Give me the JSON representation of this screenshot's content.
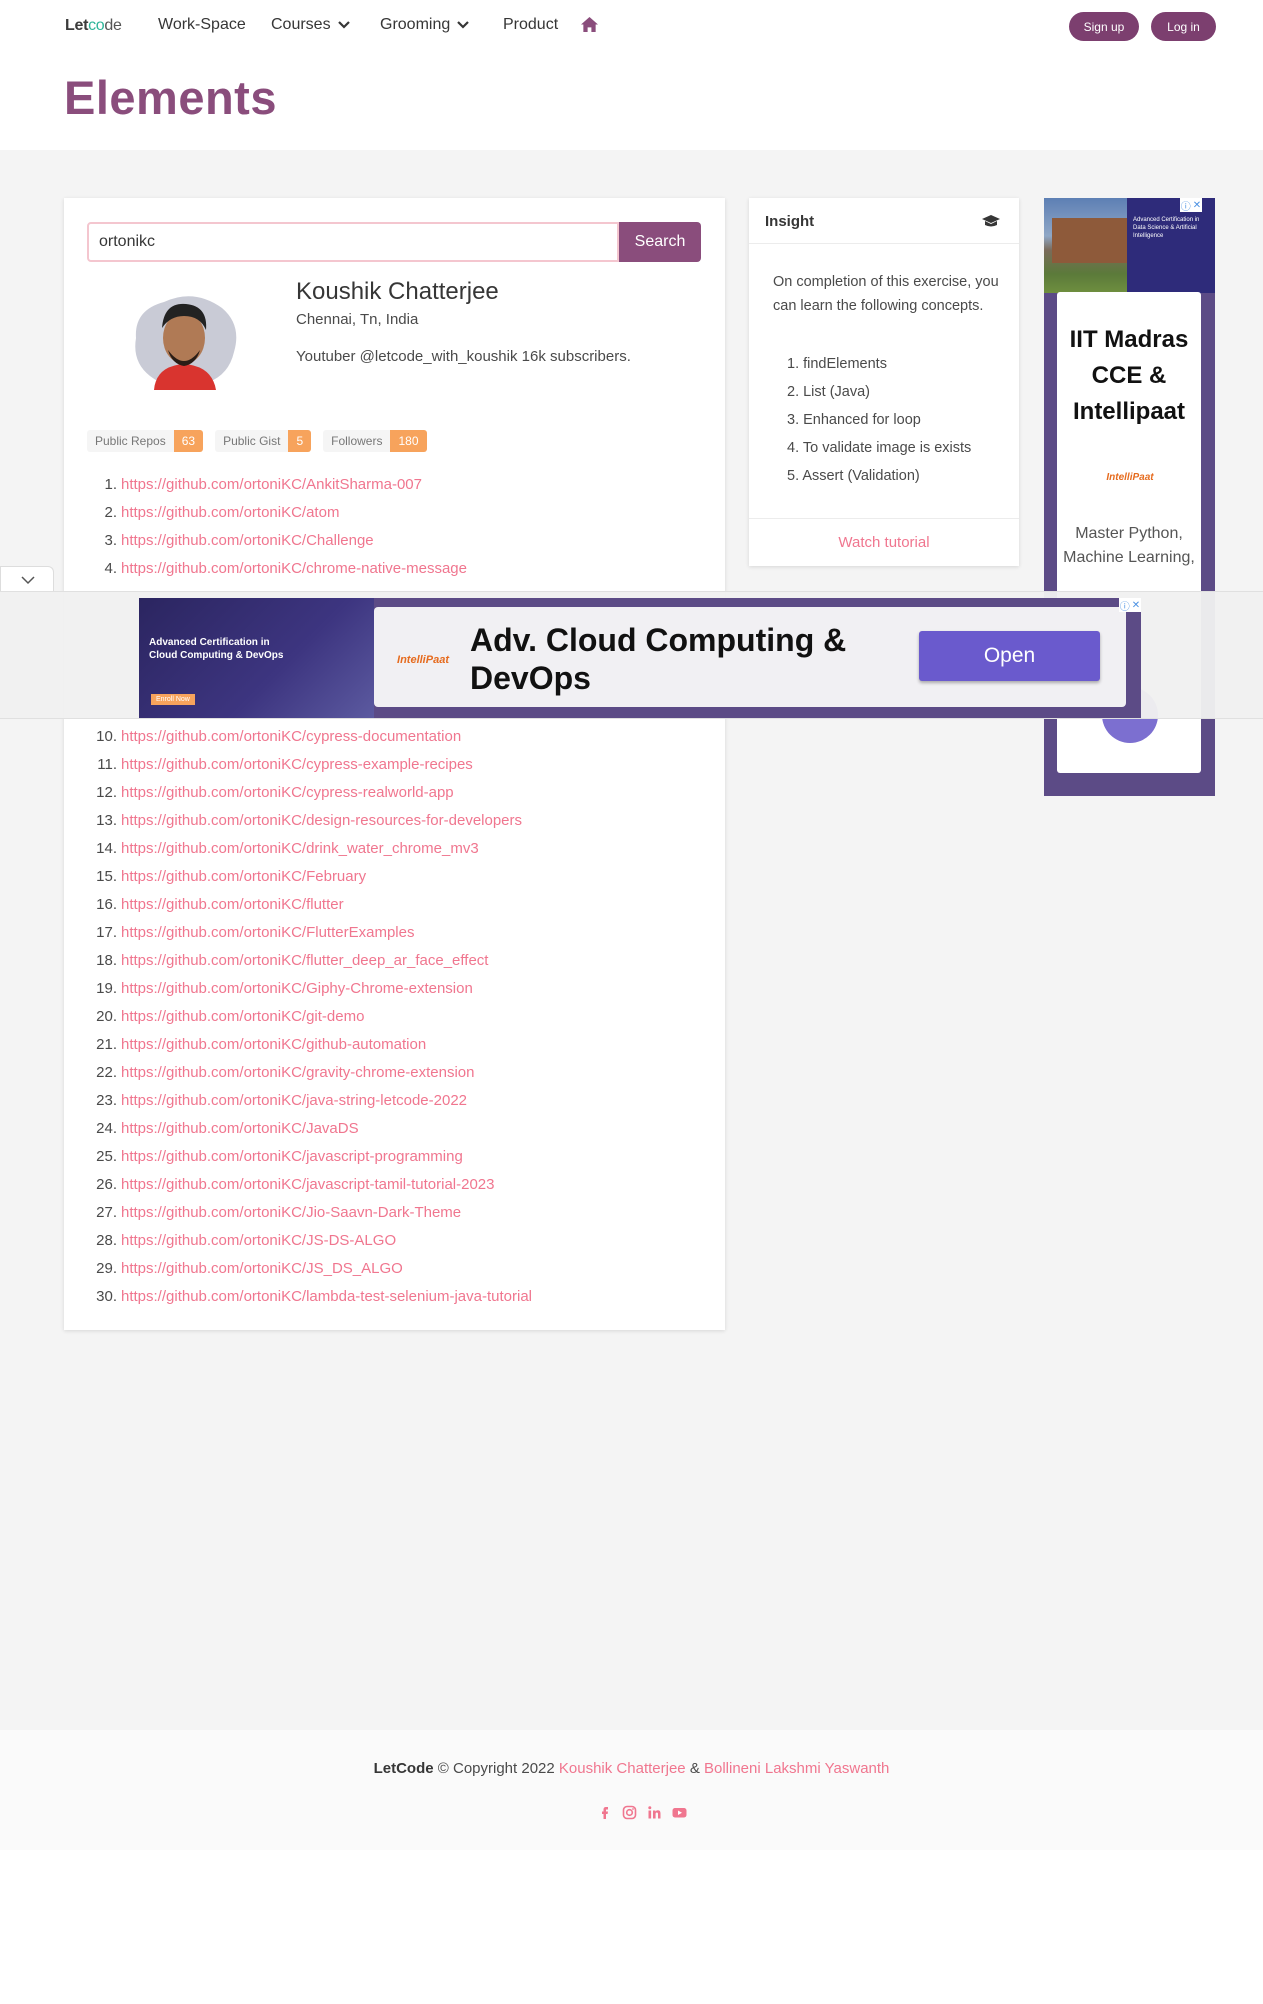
{
  "nav": {
    "logo_let": "Let",
    "logo_co": "co",
    "logo_de": "de",
    "items": [
      "Work-Space",
      "Courses",
      "Grooming",
      "Product"
    ],
    "signup": "Sign up",
    "login": "Log in"
  },
  "page": {
    "title": "Elements"
  },
  "search": {
    "value": "ortonikc",
    "button": "Search"
  },
  "profile": {
    "name": "Koushik Chatterjee",
    "location": "Chennai, Tn, India",
    "bio": "Youtuber @letcode_with_koushik 16k subscribers."
  },
  "stats": [
    {
      "label": "Public Repos",
      "value": "63"
    },
    {
      "label": "Public Gist",
      "value": "5"
    },
    {
      "label": "Followers",
      "value": "180"
    }
  ],
  "repos": [
    {
      "n": "1.",
      "url": "https://github.com/ortoniKC/AnkitSharma-007"
    },
    {
      "n": "2.",
      "url": "https://github.com/ortoniKC/atom"
    },
    {
      "n": "3.",
      "url": "https://github.com/ortoniKC/Challenge"
    },
    {
      "n": "4.",
      "url": "https://github.com/ortoniKC/chrome-native-message"
    },
    {
      "n": "10.",
      "url": "https://github.com/ortoniKC/cypress-documentation"
    },
    {
      "n": "11.",
      "url": "https://github.com/ortoniKC/cypress-example-recipes"
    },
    {
      "n": "12.",
      "url": "https://github.com/ortoniKC/cypress-realworld-app"
    },
    {
      "n": "13.",
      "url": "https://github.com/ortoniKC/design-resources-for-developers"
    },
    {
      "n": "14.",
      "url": "https://github.com/ortoniKC/drink_water_chrome_mv3"
    },
    {
      "n": "15.",
      "url": "https://github.com/ortoniKC/February"
    },
    {
      "n": "16.",
      "url": "https://github.com/ortoniKC/flutter"
    },
    {
      "n": "17.",
      "url": "https://github.com/ortoniKC/FlutterExamples"
    },
    {
      "n": "18.",
      "url": "https://github.com/ortoniKC/flutter_deep_ar_face_effect"
    },
    {
      "n": "19.",
      "url": "https://github.com/ortoniKC/Giphy-Chrome-extension"
    },
    {
      "n": "20.",
      "url": "https://github.com/ortoniKC/git-demo"
    },
    {
      "n": "21.",
      "url": "https://github.com/ortoniKC/github-automation"
    },
    {
      "n": "22.",
      "url": "https://github.com/ortoniKC/gravity-chrome-extension"
    },
    {
      "n": "23.",
      "url": "https://github.com/ortoniKC/java-string-letcode-2022"
    },
    {
      "n": "24.",
      "url": "https://github.com/ortoniKC/JavaDS"
    },
    {
      "n": "25.",
      "url": "https://github.com/ortoniKC/javascript-programming"
    },
    {
      "n": "26.",
      "url": "https://github.com/ortoniKC/javascript-tamil-tutorial-2023"
    },
    {
      "n": "27.",
      "url": "https://github.com/ortoniKC/Jio-Saavn-Dark-Theme"
    },
    {
      "n": "28.",
      "url": "https://github.com/ortoniKC/JS-DS-ALGO"
    },
    {
      "n": "29.",
      "url": "https://github.com/ortoniKC/JS_DS_ALGO"
    },
    {
      "n": "30.",
      "url": "https://github.com/ortoniKC/lambda-test-selenium-java-tutorial"
    }
  ],
  "insight": {
    "title": "Insight",
    "body": "On completion of this exercise, you can learn the following concepts.",
    "items": [
      "1. findElements",
      "2. List (Java)",
      "3. Enhanced for loop",
      "4. To validate image is exists",
      "5. Assert (Validation)"
    ],
    "footer": "Watch tutorial"
  },
  "side_ad": {
    "banner_text": "Advanced Certification in Data Science & Artificial Intelligence",
    "title": "IIT Madras CCE & Intellipaat",
    "logo": "IntelliPaat",
    "text": "Master Python, Machine Learning,"
  },
  "overlay_ad": {
    "left_text": "Advanced Certification in Cloud Computing & DevOps",
    "left_cta": "Enroll Now",
    "logo": "IntelliPaat",
    "title": "Adv. Cloud Computing & DevOps",
    "button": "Open"
  },
  "footer": {
    "brand": "LetCode",
    "copyright": "© Copyright 2022",
    "author1": "Koushik Chatterjee",
    "amp": "&",
    "author2": "Bollineni Lakshmi Yaswanth"
  },
  "colors": {
    "brand_purple": "#8a4d7c",
    "link_pink": "#f0768f",
    "badge_orange": "#f7a35c"
  }
}
